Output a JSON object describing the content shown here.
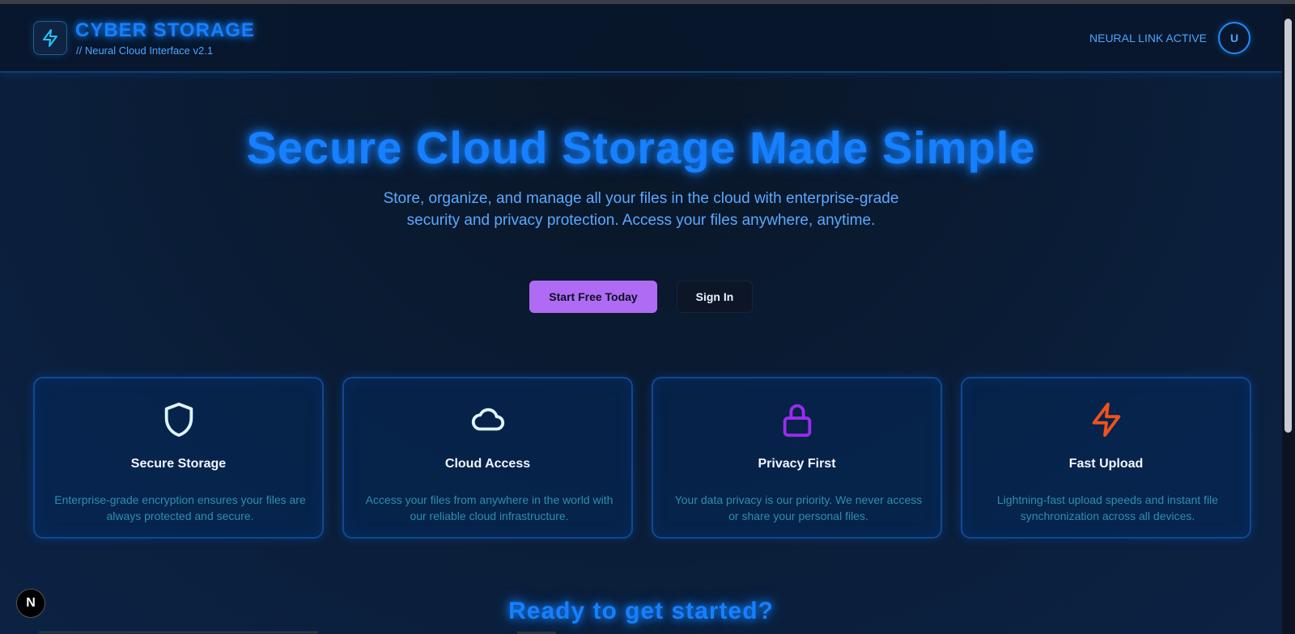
{
  "header": {
    "brand_title": "CYBER STORAGE",
    "brand_subtitle": "// Neural Cloud Interface v2.1",
    "status": "NEURAL LINK ACTIVE",
    "avatar_initial": "U",
    "logo_icon": "lightning-icon"
  },
  "hero": {
    "title": "Secure Cloud Storage Made Simple",
    "description": "Store, organize, and manage all your files in the cloud with enterprise-grade security and privacy protection. Access your files anywhere, anytime.",
    "primary_button": "Start Free Today",
    "secondary_button": "Sign In"
  },
  "features": [
    {
      "icon": "shield-icon",
      "color": "#dff4ff",
      "title": "Secure Storage",
      "description": "Enterprise-grade encryption ensures your files are always protected and secure."
    },
    {
      "icon": "cloud-icon",
      "color": "#dff4ff",
      "title": "Cloud Access",
      "description": "Access your files from anywhere in the world with our reliable cloud infrastructure."
    },
    {
      "icon": "lock-icon",
      "color": "#9b2cf0",
      "title": "Privacy First",
      "description": "Your data privacy is our priority. We never access or share your personal files."
    },
    {
      "icon": "lightning-icon",
      "color": "#f0521a",
      "title": "Fast Upload",
      "description": "Lightning-fast upload speeds and instant file synchronization across all devices."
    }
  ],
  "cta": {
    "title": "Ready to get started?"
  },
  "dev_badge": {
    "label": "N"
  },
  "colors": {
    "accent": "#1680ff",
    "primary_button": "#b06bf5",
    "background": "#0b1322"
  }
}
